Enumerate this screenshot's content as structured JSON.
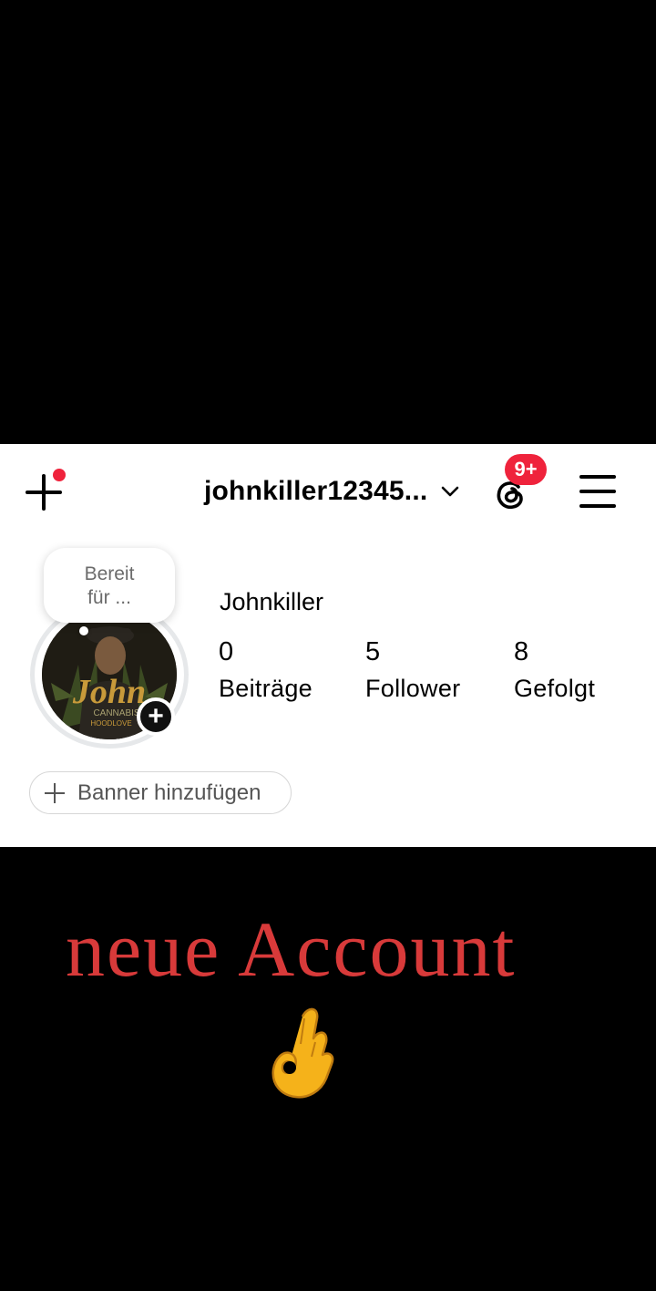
{
  "header": {
    "username": "johnkiller12345...",
    "notification_badge": "9+",
    "icons": [
      "plus-icon",
      "chevron-down-icon",
      "threads-icon",
      "hamburger-menu-icon"
    ]
  },
  "profile": {
    "bubble_line1": "Bereit",
    "bubble_line2": "für ...",
    "display_name": "Johnkiller",
    "avatar_text": "John",
    "avatar_subtext": "CANNABIS",
    "avatar_subtext2": "HOODLOVE",
    "stats": [
      {
        "value": "0",
        "label": "Beiträge"
      },
      {
        "value": "5",
        "label": "Follower"
      },
      {
        "value": "8",
        "label": "Gefolgt"
      }
    ],
    "banner_button": "Banner hinzufügen"
  },
  "overlay": {
    "caption": "neue Account",
    "emoji": "ok-hand-emoji"
  },
  "colors": {
    "accent_red": "#ef233c",
    "caption_red": "#d83a3a"
  }
}
